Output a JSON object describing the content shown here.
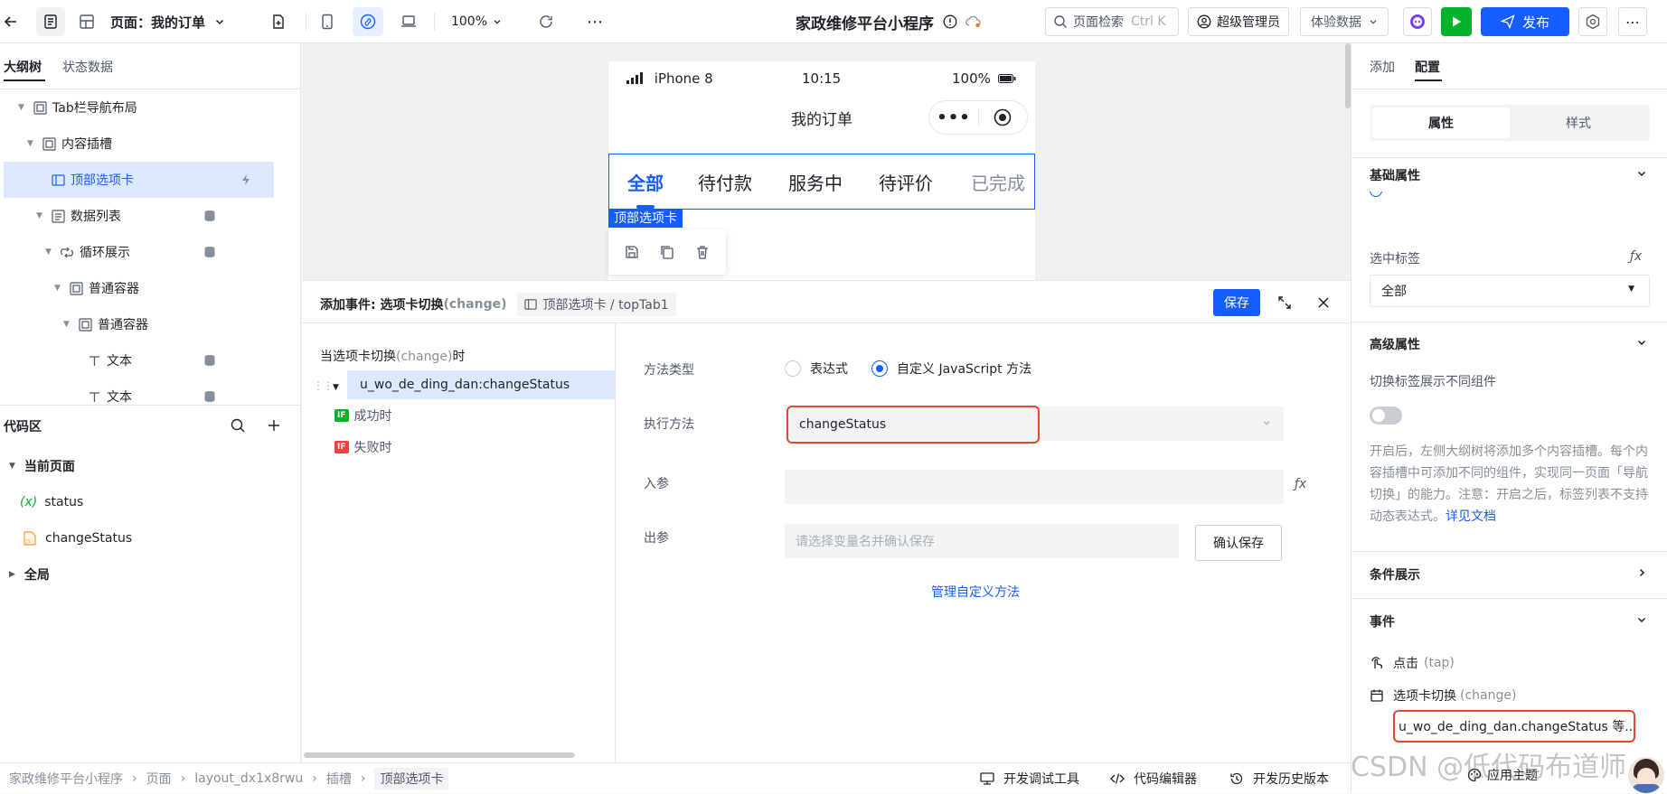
{
  "topbar": {
    "page_prefix": "页面：",
    "page_name": "我的订单",
    "zoom": "100%",
    "app_title": "家政维修平台小程序",
    "search_placeholder": "页面检索",
    "search_shortcut": "Ctrl K",
    "role_label": "超级管理员",
    "data_mode": "体验数据",
    "publish_label": "发布"
  },
  "left": {
    "tabs": [
      "大纲树",
      "状态数据"
    ],
    "tree": [
      {
        "label": "Tab栏导航布局"
      },
      {
        "label": "内容插槽"
      },
      {
        "label": "顶部选项卡"
      },
      {
        "label": "数据列表"
      },
      {
        "label": "循环展示"
      },
      {
        "label": "普通容器"
      },
      {
        "label": "普通容器"
      },
      {
        "label": "文本"
      },
      {
        "label": "文本"
      }
    ],
    "code_title": "代码区",
    "code_items": {
      "current_page": "当前页面",
      "status": "status",
      "status_icon_text": "(x)",
      "change_status": "changeStatus",
      "global": "全局"
    }
  },
  "phone": {
    "device": "iPhone 8",
    "time": "10:15",
    "battery": "100%",
    "page_title": "我的订单",
    "tabs": [
      "全部",
      "待付款",
      "服务中",
      "待评价",
      "已完成"
    ],
    "selected_label": "顶部选项卡"
  },
  "event": {
    "title_prefix": "添加事件: 选项卡切换",
    "title_event": "(change)",
    "component_path": "顶部选项卡 / topTab1",
    "save_label": "保存",
    "trigger_prefix": "当选项卡切换",
    "trigger_event": "(change)",
    "trigger_suffix": "时",
    "action_name": "u_wo_de_ding_dan:changeStatus",
    "if_badge": "IF",
    "success_label": "成功时",
    "fail_label": "失败时",
    "method_type_label": "方法类型",
    "radio_expression": "表达式",
    "radio_custom": "自定义 JavaScript 方法",
    "exec_method_label": "执行方法",
    "exec_method_value": "changeStatus",
    "params_label": "入参",
    "output_label": "出参",
    "output_placeholder": "请选择变量名并确认保存",
    "confirm_save": "确认保存",
    "manage_link": "管理自定义方法"
  },
  "right": {
    "tabs": [
      "添加",
      "配置"
    ],
    "seg": [
      "属性",
      "样式"
    ],
    "basic_title": "基础属性",
    "selected_tab_label": "选中标签",
    "selected_tab_value": "全部",
    "advanced_title": "高级属性",
    "switch_label": "切换标签展示不同组件",
    "switch_on": false,
    "desc": "开启后，左侧大纲树将添加多个内容插槽。每个内容插槽中可添加不同的组件，实现同一页面「导航切换」的能力。注意：开启之后，标签列表不支持动态表达式。",
    "desc_link": "详见文档",
    "cond_title": "条件展示",
    "events_title": "事件",
    "event_tap": "点击",
    "event_tap_code": "(tap)",
    "event_change": "选项卡切换",
    "event_change_code": "(change)",
    "event_change_handler": "u_wo_de_ding_dan.changeStatus 等...",
    "theme_label": "应用主题"
  },
  "status": {
    "breadcrumb": [
      "家政维修平台小程序",
      "页面",
      "layout_dx1x8rwu",
      "插槽",
      "顶部选项卡"
    ],
    "tools": [
      "开发调试工具",
      "代码编辑器",
      "开发历史版本"
    ]
  },
  "watermark": "CSDN @低代码布道师",
  "colors": {
    "primary": "#165dff",
    "green": "#00b42a",
    "red_outline": "#e8462b"
  }
}
